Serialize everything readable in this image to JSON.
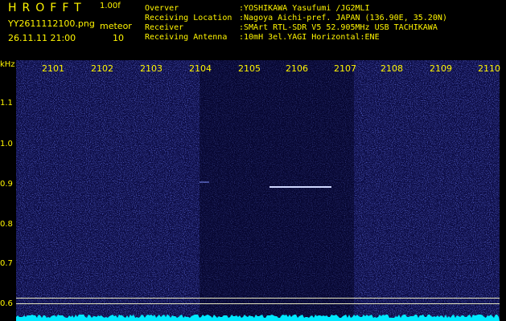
{
  "header": {
    "app_title": "HROFFT",
    "version": "1.00f",
    "file_name": "YY2611112100.png",
    "mode": "meteor",
    "date_time": "26.11.11 21:00",
    "count": "10",
    "info": [
      {
        "label": "Overver",
        "value": ":YOSHIKAWA Yasufumi /JG2MLI"
      },
      {
        "label": "Receiving Location",
        "value": ":Nagoya Aichi-pref. JAPAN (136.90E, 35.20N)"
      },
      {
        "label": "Receiver",
        "value": ":SMArt RTL-SDR V5 52.905MHz USB TACHIKAWA"
      },
      {
        "label": "Receiving Antenna",
        "value": ":10mH 3el.YAGI Horizontal:ENE"
      }
    ]
  },
  "axis": {
    "y_unit": "kHz",
    "y_ticks": [
      "1.1",
      "1.0",
      "0.9",
      "0.8",
      "0.7",
      "0.6"
    ],
    "x_ticks": [
      "2101",
      "2102",
      "2103",
      "2104",
      "2105",
      "2106",
      "2107",
      "2108",
      "2109",
      "2110"
    ]
  },
  "colors": {
    "background": "#000000",
    "label": "#fff500",
    "waterfall_noise": "#2030c0",
    "spectrum": "#00e8ff"
  }
}
